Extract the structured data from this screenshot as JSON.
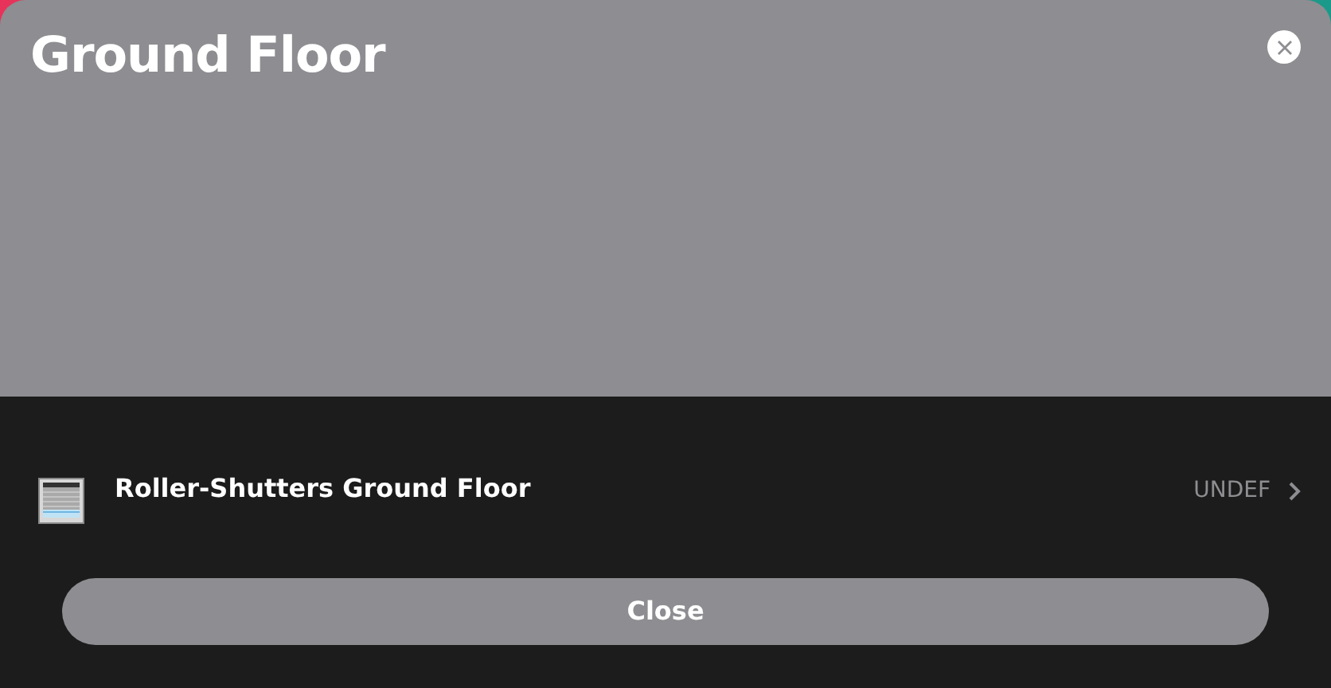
{
  "header": {
    "title": "Ground Floor"
  },
  "items": [
    {
      "label": "Roller-Shutters Ground Floor",
      "value": "UNDEF"
    }
  ],
  "footer": {
    "button": "Close"
  }
}
